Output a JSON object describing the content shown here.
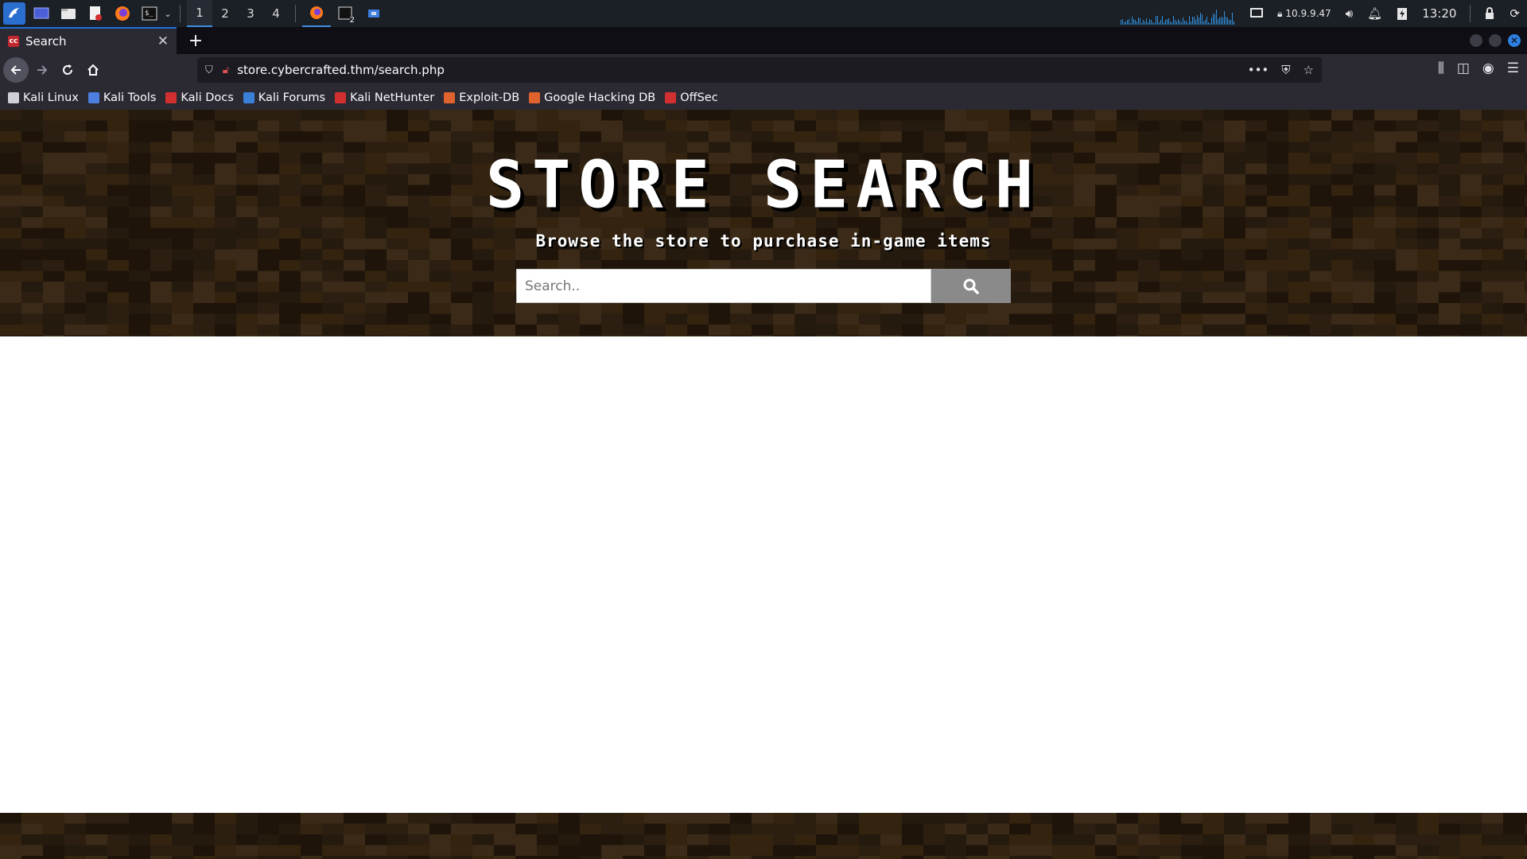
{
  "taskbar": {
    "workspaces": [
      "1",
      "2",
      "3",
      "4"
    ],
    "active_workspace": "1",
    "ip_address": "10.9.9.47",
    "clock": "13:20",
    "terminal_badge": "2"
  },
  "browser": {
    "tab_title": "Search",
    "tab_favicon_text": "cc",
    "url": "store.cybercrafted.thm/search.php",
    "bookmarks": [
      {
        "label": "Kali Linux",
        "icon": "kali-dragon-icon",
        "color": "#cfcfd8"
      },
      {
        "label": "Kali Tools",
        "icon": "kali-tools-icon",
        "color": "#4c7fe0"
      },
      {
        "label": "Kali Docs",
        "icon": "kali-docs-icon",
        "color": "#d03030"
      },
      {
        "label": "Kali Forums",
        "icon": "kali-forums-icon",
        "color": "#3a7fd8"
      },
      {
        "label": "Kali NetHunter",
        "icon": "nethunter-icon",
        "color": "#d03030"
      },
      {
        "label": "Exploit-DB",
        "icon": "exploit-db-icon",
        "color": "#e0622c"
      },
      {
        "label": "Google Hacking DB",
        "icon": "ghdb-icon",
        "color": "#e0622c"
      },
      {
        "label": "OffSec",
        "icon": "offsec-icon",
        "color": "#d03030"
      }
    ]
  },
  "hero": {
    "title": "STORE SEARCH",
    "subtitle": "Browse the store to purchase in-game items"
  },
  "search": {
    "placeholder": "Search..",
    "value": ""
  },
  "colors": {
    "accent": "#1f6fd6",
    "dirt_dark": "#1e140a",
    "dirt_mid": "#2c1f11",
    "dirt_light": "#3a2a17",
    "search_button": "#8a8a8a"
  }
}
